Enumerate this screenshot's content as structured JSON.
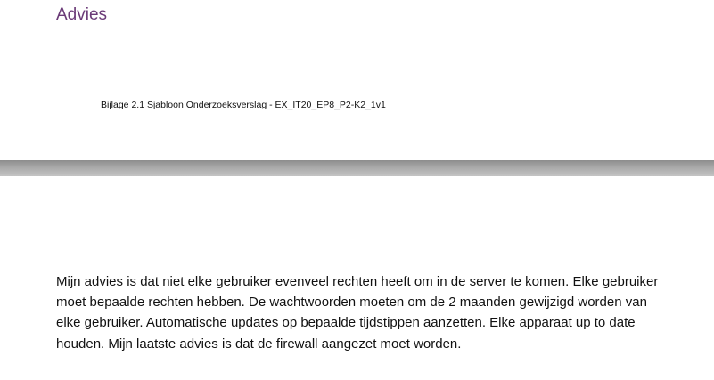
{
  "page1": {
    "heading": "Advies",
    "footer": "Bijlage 2.1 Sjabloon Onderzoeksverslag - EX_IT20_EP8_P2-K2_1v1"
  },
  "page2": {
    "paragraph": "Mijn advies is dat niet elke gebruiker evenveel rechten heeft om in de server te komen. Elke gebruiker moet bepaalde rechten hebben. De wachtwoorden moeten om de 2 maanden gewijzigd worden van elke gebruiker. Automatische updates op bepaalde tijdstippen aanzetten. Elke apparaat up to date houden. Mijn laatste advies is dat de firewall aangezet moet worden."
  },
  "colors": {
    "heading": "#6b3b78",
    "text": "#111111",
    "page_gap": "#a9a9a9"
  }
}
